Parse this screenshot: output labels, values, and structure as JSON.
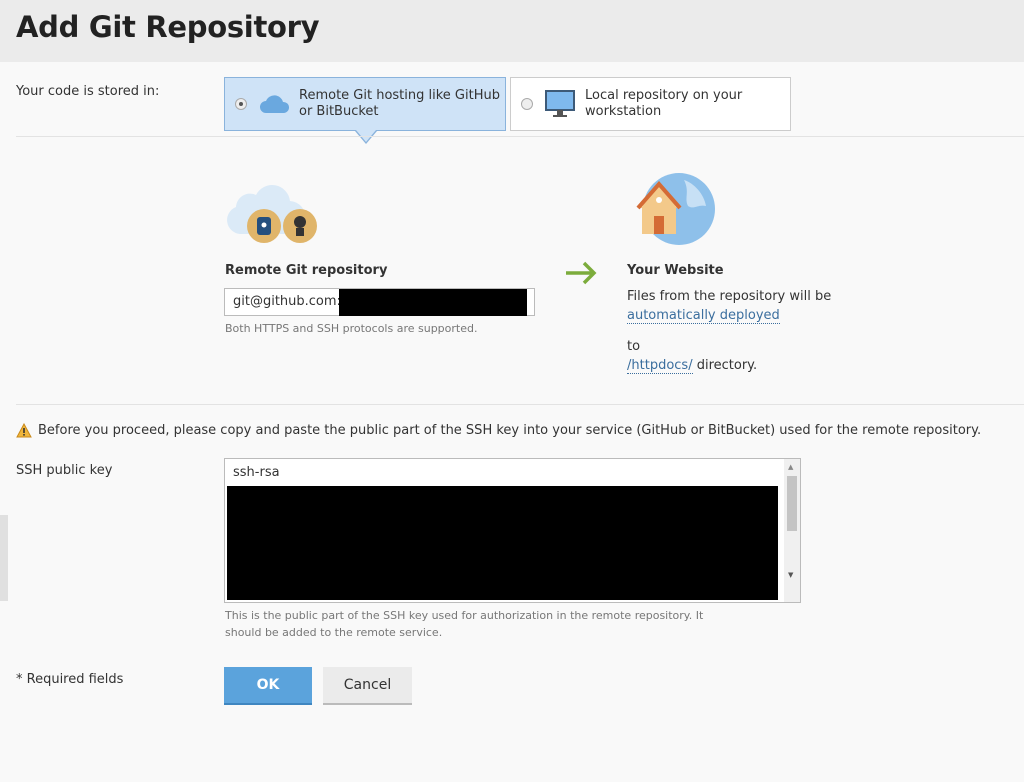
{
  "header": {
    "title": "Add Git Repository"
  },
  "storage": {
    "label": "Your code is stored in:",
    "options": [
      {
        "label": "Remote Git hosting like GitHub or BitBucket",
        "selected": true,
        "icon": "cloud-icon"
      },
      {
        "label": "Local repository on your workstation",
        "selected": false,
        "icon": "monitor-icon"
      }
    ]
  },
  "remote": {
    "heading": "Remote Git repository",
    "url_value": "git@github.com:",
    "url_redacted": true,
    "hint": "Both HTTPS and SSH protocols are supported."
  },
  "website": {
    "heading": "Your Website",
    "line1": "Files from the repository will be",
    "link1": "automatically deployed",
    "to": "to",
    "link2": "/httpdocs/",
    "line2": "directory."
  },
  "warning": "Before you proceed, please copy and paste the public part of the SSH key into your service (GitHub or BitBucket) used for the remote repository.",
  "ssh": {
    "label": "SSH public key",
    "value": "ssh-rsa",
    "redacted": true,
    "hint": "This is the public part of the SSH key used for authorization in the remote repository. It should be added to the remote service."
  },
  "footer": {
    "required": "* Required fields",
    "ok": "OK",
    "cancel": "Cancel"
  },
  "colors": {
    "ok": "#5ba3dc",
    "selected_option": "#cfe3f7",
    "link": "#3b6e9e",
    "arrow": "#7cac3c"
  }
}
